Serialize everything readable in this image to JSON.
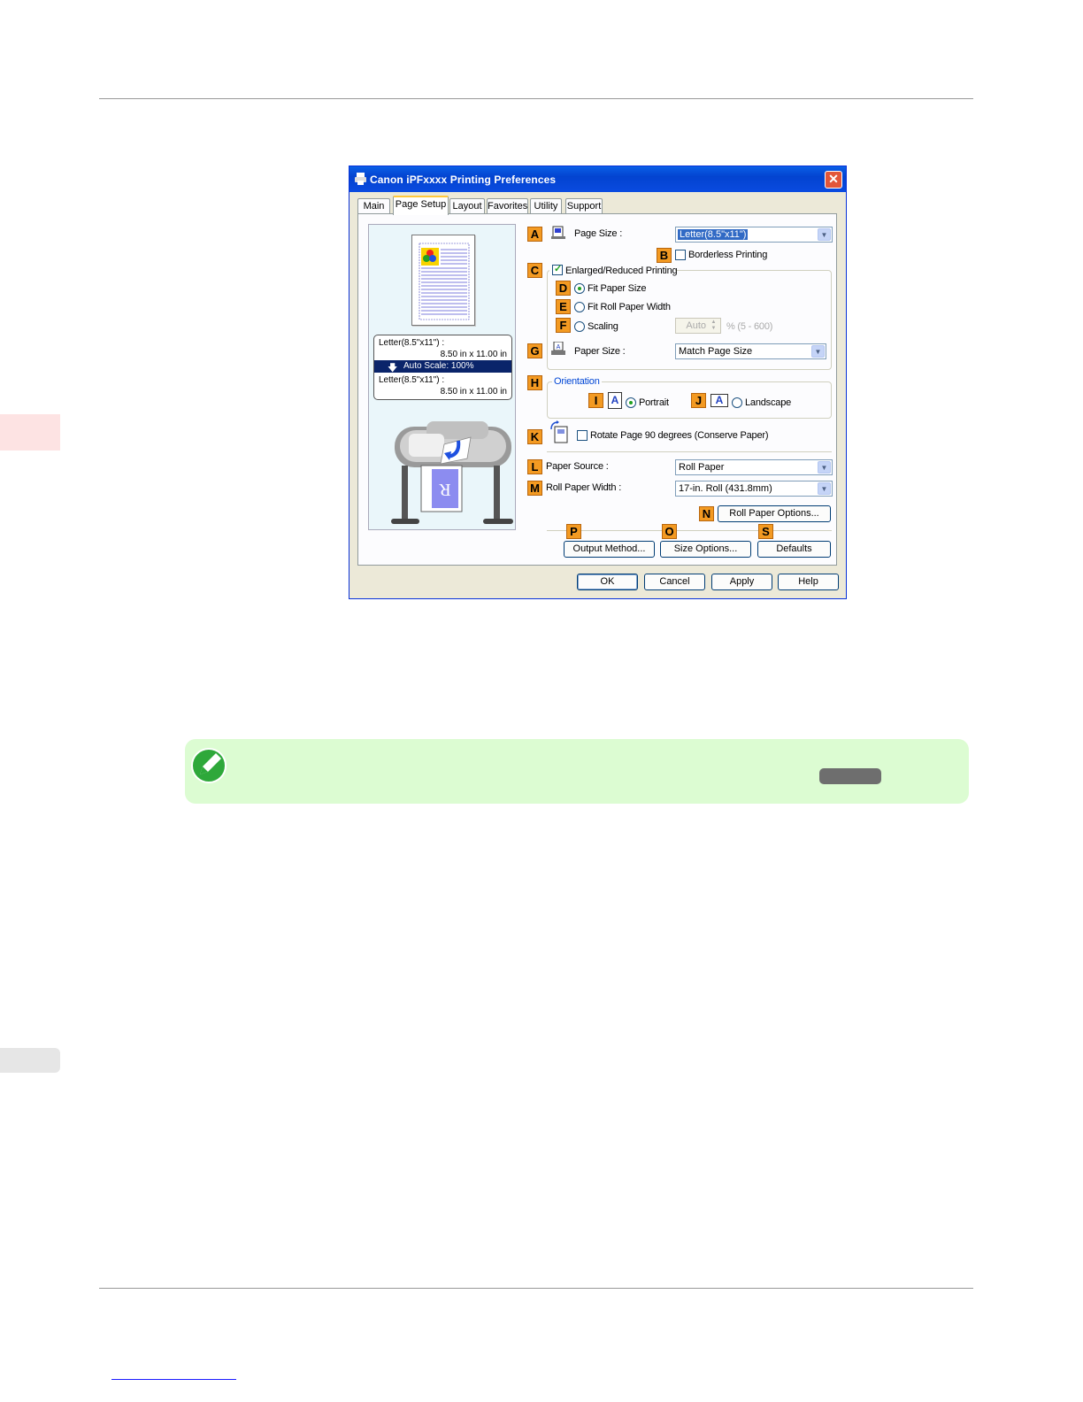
{
  "dialog": {
    "title": "Canon iPFxxxx Printing Preferences",
    "close_glyph": "✕",
    "tabs": [
      "Main",
      "Page Setup",
      "Layout",
      "Favorites",
      "Utility",
      "Support"
    ],
    "active_tab": "Page Setup",
    "preview": {
      "line1": "Letter(8.5\"x11\") :",
      "line2": "8.50 in x 11.00 in",
      "autoscale": "Auto Scale: 100%",
      "line3": "Letter(8.5\"x11\") :",
      "line4": "8.50 in x 11.00 in"
    },
    "markers": {
      "A": "A",
      "B": "B",
      "C": "C",
      "D": "D",
      "E": "E",
      "F": "F",
      "G": "G",
      "H": "H",
      "I": "I",
      "J": "J",
      "K": "K",
      "L": "L",
      "M": "M",
      "N": "N",
      "P": "P",
      "O": "O",
      "S": "S"
    },
    "page_size_label": "Page Size :",
    "page_size_value": "Letter(8.5\"x11\")",
    "borderless_label": "Borderless Printing",
    "enlarged_label": "Enlarged/Reduced Printing",
    "fit_paper_size": "Fit Paper Size",
    "fit_roll_width": "Fit Roll Paper Width",
    "scaling_label": "Scaling",
    "scaling_value": "Auto",
    "scaling_range": "% (5 - 600)",
    "paper_size_label": "Paper Size :",
    "paper_size_value": "Match Page Size",
    "orientation_label": "Orientation",
    "portrait_label": "Portrait",
    "landscape_label": "Landscape",
    "orient_icon_glyph": "A",
    "rotate_label": "Rotate Page 90 degrees (Conserve Paper)",
    "paper_source_label": "Paper Source :",
    "paper_source_value": "Roll Paper",
    "roll_width_label": "Roll Paper Width :",
    "roll_width_value": "17-in. Roll (431.8mm)",
    "roll_options_button": "Roll Paper Options...",
    "output_method_button": "Output Method...",
    "size_options_button": "Size Options...",
    "defaults_button": "Defaults",
    "ok_button": "OK",
    "cancel_button": "Cancel",
    "apply_button": "Apply",
    "help_button": "Help",
    "preview_letter": "R"
  },
  "colors": {
    "side_tab_pink": "#fde3e3",
    "side_tab_gray": "#e6e6e6",
    "note_bg": "#dcfcd2",
    "marker_orange": "#f39a22",
    "footer_link": "#1a1aff"
  }
}
